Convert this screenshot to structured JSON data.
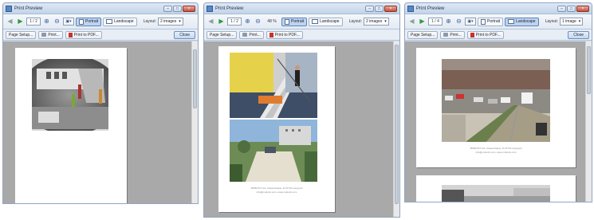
{
  "windows": [
    {
      "title": "Print Preview",
      "page_indicator": "1 / 2",
      "zoom_value": "",
      "portrait_label": "Portrait",
      "landscape_label": "Landscape",
      "layout_label": "Layout:",
      "layout_value": "2 images",
      "page_setup_label": "Page Setup...",
      "print_label": "Print...",
      "print_pdf_label": "Print to PDF...",
      "close_label": "Close",
      "orientation": "portrait"
    },
    {
      "title": "Print Preview",
      "page_indicator": "1 / 2",
      "zoom_value": "48 %",
      "portrait_label": "Portrait",
      "landscape_label": "Landscape",
      "layout_label": "Layout:",
      "layout_value": "2 images",
      "page_setup_label": "Page Setup...",
      "print_label": "Print...",
      "print_pdf_label": "Print to PDF...",
      "close_label": "",
      "orientation": "portrait",
      "caption_line1": "MOBOTIX AG, Kaiserstrasse, D-67722 Langmeil",
      "caption_line2": "info@mobotix.com, www.mobotix.com"
    },
    {
      "title": "Print Preview",
      "page_indicator": "1 / 4",
      "zoom_value": "",
      "portrait_label": "Portrait",
      "landscape_label": "Landscape",
      "layout_label": "Layout:",
      "layout_value": "1 image",
      "page_setup_label": "Page Setup...",
      "print_label": "Print...",
      "print_pdf_label": "Print to PDF...",
      "close_label": "Close",
      "orientation": "landscape",
      "caption_line1": "MOBOTIX AG, Kaiserstrasse, D-67722 Langmeil",
      "caption_line2": "info@mobotix.com, www.mobotix.com"
    }
  ],
  "icons": {
    "back": "left-arrow-icon",
    "forward": "right-arrow-icon",
    "zoom_in": "zoom-in-icon",
    "zoom_out": "zoom-out-icon",
    "fit": "fit-page-icon",
    "window_icon": "print-preview-icon"
  },
  "colors": {
    "active_button": "#bdd3ef",
    "canvas": "#a9a9a9",
    "title_bar": "#c3d4e9"
  }
}
